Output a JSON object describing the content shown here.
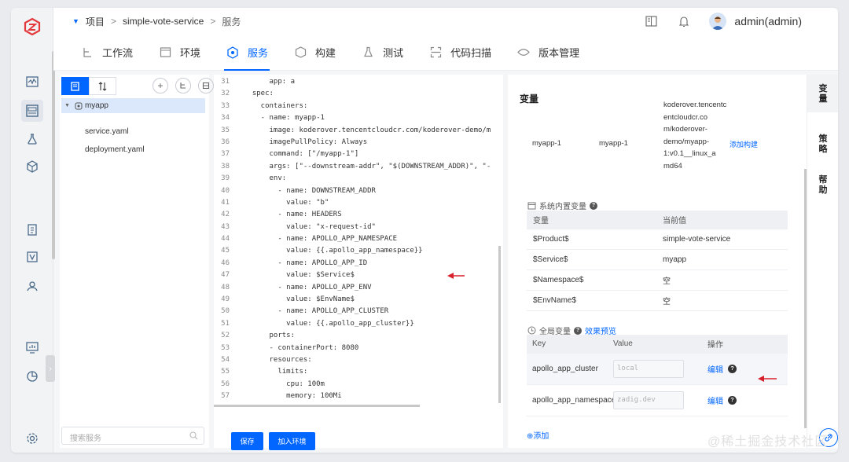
{
  "breadcrumb": {
    "project": "项目",
    "service": "simple-vote-service",
    "page": "服务"
  },
  "user": {
    "name": "admin(admin)"
  },
  "tabs": [
    "工作流",
    "环境",
    "服务",
    "构建",
    "测试",
    "代码扫描",
    "版本管理"
  ],
  "tree": {
    "root": "myapp",
    "files": [
      "service.yaml",
      "deployment.yaml"
    ],
    "search_placeholder": "搜索服务"
  },
  "code": [
    [
      "31",
      "      app: a"
    ],
    [
      "32",
      "  spec:"
    ],
    [
      "33",
      "    containers:"
    ],
    [
      "34",
      "    - name: myapp-1"
    ],
    [
      "35",
      "      image: koderover.tencentcloudcr.com/koderover-demo/m"
    ],
    [
      "36",
      "      imagePullPolicy: Always"
    ],
    [
      "37",
      "      command: [\"/myapp-1\"]"
    ],
    [
      "38",
      "      args: [\"--downstream-addr\", \"$(DOWNSTREAM_ADDR)\", \"-"
    ],
    [
      "39",
      "      env:"
    ],
    [
      "40",
      "        - name: DOWNSTREAM_ADDR"
    ],
    [
      "41",
      "          value: \"b\""
    ],
    [
      "42",
      "        - name: HEADERS"
    ],
    [
      "43",
      "          value: \"x-request-id\""
    ],
    [
      "44",
      "        - name: APOLLO_APP_NAMESPACE"
    ],
    [
      "45",
      "          value: {{.apollo_app_namespace}}"
    ],
    [
      "46",
      "        - name: APOLLO_APP_ID"
    ],
    [
      "47",
      "          value: $Service$"
    ],
    [
      "48",
      "        - name: APOLLO_APP_ENV"
    ],
    [
      "49",
      "          value: $EnvName$"
    ],
    [
      "50",
      "        - name: APOLLO_APP_CLUSTER"
    ],
    [
      "51",
      "          value: {{.apollo_app_cluster}}"
    ],
    [
      "52",
      "      ports:"
    ],
    [
      "53",
      "      - containerPort: 8080"
    ],
    [
      "54",
      "      resources:"
    ],
    [
      "55",
      "        limits:"
    ],
    [
      "56",
      "          cpu: 100m"
    ],
    [
      "57",
      "          memory: 100Mi"
    ]
  ],
  "buttons": {
    "save": "保存",
    "join_env": "加入环境"
  },
  "panel": {
    "title": "变量",
    "build_row": {
      "name1": "myapp-1",
      "name2": "myapp-1",
      "image_lines": [
        "koderover.tencentc",
        "entcloudcr.co",
        "m/koderover-",
        "demo/myapp-",
        "1:v0.1__linux_a",
        "md64"
      ],
      "action": "添加构建"
    },
    "sys_vars": {
      "title": "系统内置变量",
      "col_var": "变量",
      "col_val": "当前值",
      "rows": [
        [
          "$Product$",
          "simple-vote-service"
        ],
        [
          "$Service$",
          "myapp"
        ],
        [
          "$Namespace$",
          "空"
        ],
        [
          "$EnvName$",
          "空"
        ]
      ]
    },
    "global_vars": {
      "title": "全局变量",
      "preview": "效果预览",
      "col_key": "Key",
      "col_value": "Value",
      "col_op": "操作",
      "rows": [
        {
          "key": "apollo_app_cluster",
          "value": "local",
          "op": "编辑"
        },
        {
          "key": "apollo_app_namespace",
          "value": "zadig.dev",
          "op": "编辑"
        }
      ],
      "add": "⊕添加"
    }
  },
  "right_nav": [
    "变量",
    "策略",
    "帮助"
  ],
  "watermark": "@稀土掘金技术社区"
}
